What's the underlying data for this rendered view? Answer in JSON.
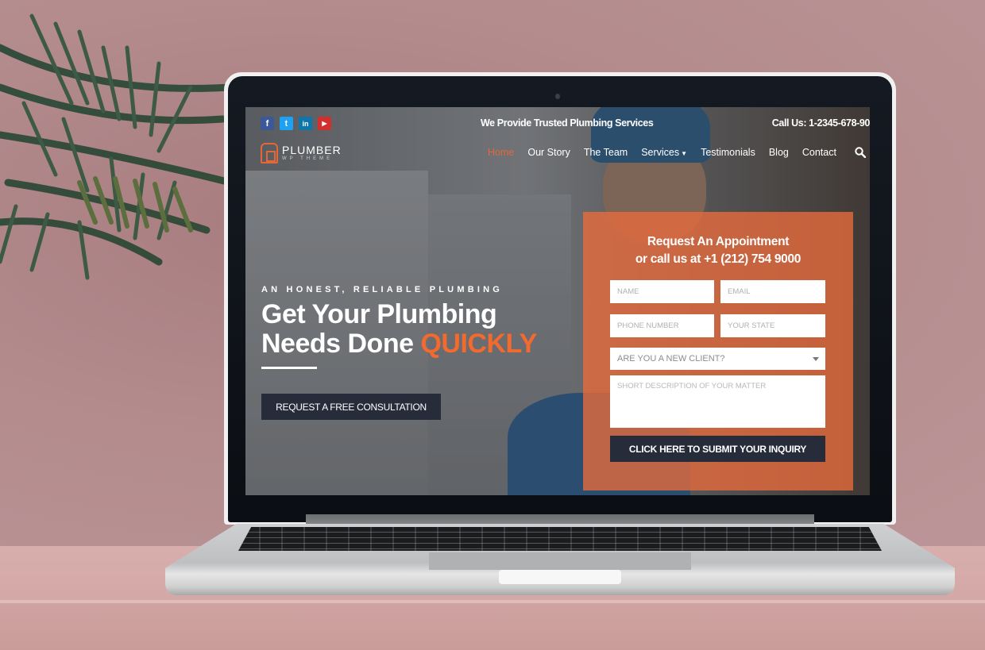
{
  "topbar": {
    "social": [
      {
        "name": "facebook",
        "glyph": "f",
        "color": "#3b5998"
      },
      {
        "name": "twitter",
        "glyph": "t",
        "color": "#1da1f2"
      },
      {
        "name": "linkedin",
        "glyph": "in",
        "color": "#0e76a8"
      },
      {
        "name": "youtube",
        "glyph": "▶",
        "color": "#d32f2f"
      }
    ],
    "tagline": "We Provide Trusted Plumbing Services",
    "call_us": "Call Us: 1-2345-678-90"
  },
  "logo": {
    "line1": "PLUMBER",
    "line2": "WP THEME"
  },
  "nav": {
    "items": [
      {
        "label": "Home",
        "active": true
      },
      {
        "label": "Our Story"
      },
      {
        "label": "The Team"
      },
      {
        "label": "Services",
        "has_dropdown": true
      },
      {
        "label": "Testimonials"
      },
      {
        "label": "Blog"
      },
      {
        "label": "Contact"
      }
    ]
  },
  "hero": {
    "eyebrow": "AN HONEST, RELIABLE PLUMBING",
    "headline_line1": "Get Your Plumbing",
    "headline_line2": "Needs Done ",
    "headline_accent": "QUICKLY",
    "cta_label": "REQUEST A FREE CONSULTATION"
  },
  "form": {
    "title_line1": "Request An Appointment",
    "title_line2": "or call us at +1 (212) 754 9000",
    "name_placeholder": "NAME",
    "email_placeholder": "EMAIL",
    "phone_placeholder": "PHONE NUMBER",
    "state_placeholder": "YOUR STATE",
    "client_select": "ARE YOU A NEW CLIENT?",
    "description_placeholder": "SHORT DESCRIPTION OF YOUR MATTER",
    "submit_label": "CLICK HERE TO SUBMIT YOUR INQUIRY"
  },
  "colors": {
    "accent": "#f26a2e",
    "dark_button": "#272c3b",
    "form_panel": "#e96c3c"
  }
}
